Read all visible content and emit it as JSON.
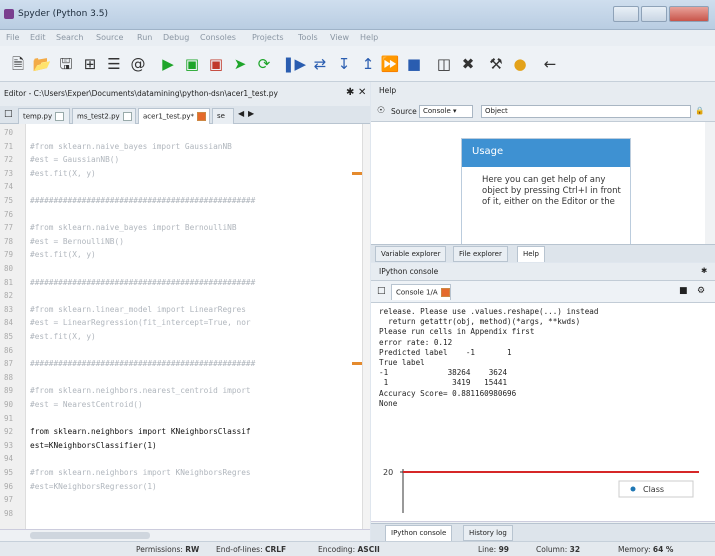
{
  "window": {
    "title": "Spyder (Python 3.5)"
  },
  "menu": [
    "File",
    "Edit",
    "Search",
    "Source",
    "Run",
    "Debug",
    "Consoles",
    "Projects",
    "Tools",
    "View",
    "Help"
  ],
  "editor": {
    "path": "Editor - C:\\Users\\Exper\\Documents\\datamining\\python-dsn\\acer1_test.py",
    "tabs": [
      "temp.py",
      "ms_test2.py",
      "acer1_test.py*",
      "se"
    ],
    "lines": [
      {
        "n": "70",
        "text": ""
      },
      {
        "n": "71",
        "text": "#from sklearn.naive_bayes import GaussianNB"
      },
      {
        "n": "72",
        "text": "#est = GaussianNB()"
      },
      {
        "n": "73",
        "text": "#est.fit(X, y)"
      },
      {
        "n": "74",
        "text": ""
      },
      {
        "n": "75",
        "text": "################################################"
      },
      {
        "n": "76",
        "text": ""
      },
      {
        "n": "77",
        "text": "#from sklearn.naive_bayes import BernoulliNB"
      },
      {
        "n": "78",
        "text": "#est = BernoulliNB()"
      },
      {
        "n": "79",
        "text": "#est.fit(X, y)"
      },
      {
        "n": "80",
        "text": ""
      },
      {
        "n": "81",
        "text": "################################################"
      },
      {
        "n": "82",
        "text": ""
      },
      {
        "n": "83",
        "text": "#from sklearn.linear_model import LinearRegres"
      },
      {
        "n": "84",
        "text": "#est = LinearRegression(fit_intercept=True, nor"
      },
      {
        "n": "85",
        "text": "#est.fit(X, y)"
      },
      {
        "n": "86",
        "text": ""
      },
      {
        "n": "87",
        "text": "################################################"
      },
      {
        "n": "88",
        "text": ""
      },
      {
        "n": "89",
        "text": "#from sklearn.neighbors.nearest_centroid import"
      },
      {
        "n": "90",
        "text": "#est = NearestCentroid()"
      },
      {
        "n": "91",
        "text": ""
      },
      {
        "n": "92",
        "text": "from sklearn.neighbors import KNeighborsClassif"
      },
      {
        "n": "93",
        "text": "est=KNeighborsClassifier(1)"
      },
      {
        "n": "94",
        "text": ""
      },
      {
        "n": "95",
        "text": "#from sklearn.neighbors import KNeighborsRegres"
      },
      {
        "n": "96",
        "text": "#est=KNeighborsRegressor(1)"
      },
      {
        "n": "97",
        "text": ""
      },
      {
        "n": "98",
        "text": ""
      }
    ]
  },
  "help": {
    "title": "Help",
    "source_label": "Source",
    "source_value": "Console",
    "object_label": "Object",
    "usage_title": "Usage",
    "usage_text": "Here you can get help of any object by pressing Ctrl+I in front of it, either on the Editor or the",
    "tabs": [
      "Variable explorer",
      "File explorer",
      "Help"
    ]
  },
  "console": {
    "title": "IPython console",
    "tab": "Console 1/A",
    "output": "release. Please use .values.reshape(...) instead\n  return getattr(obj, method)(*args, **kwds)\nPlease run cells in Appendix first\nerror rate: 0.12\nPredicted label    -1       1\nTrue label\n-1             38264    3624\n 1              3419   15441\nAccuracy Score= 0.881160980696\nNone",
    "plot_tick": "20",
    "legend": "Class",
    "tabs": [
      "IPython console",
      "History log"
    ]
  },
  "status": {
    "permissions_label": "Permissions:",
    "permissions": "RW",
    "eol_label": "End-of-lines:",
    "eol": "CRLF",
    "encoding_label": "Encoding:",
    "encoding": "ASCII",
    "line_label": "Line:",
    "line": "99",
    "column_label": "Column:",
    "column": "32",
    "memory_label": "Memory:",
    "memory": "64 %"
  }
}
